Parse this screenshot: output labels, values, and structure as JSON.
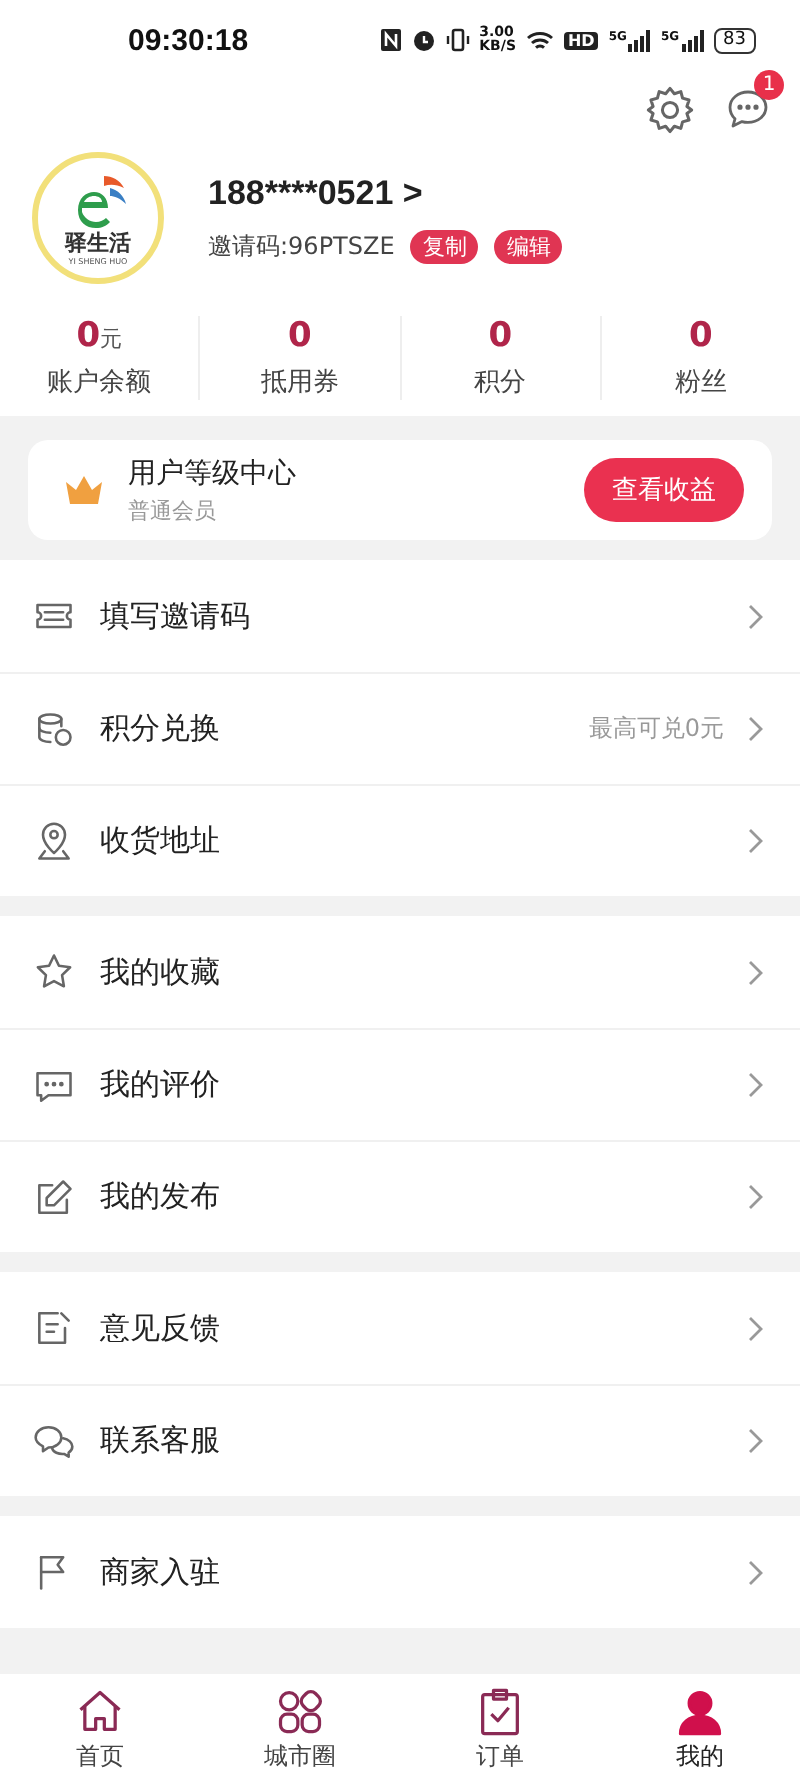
{
  "status_bar": {
    "time": "09:30:18",
    "speed_value": "3.00",
    "speed_unit": "KB/S",
    "hd": "HD",
    "signals": [
      "5G",
      "5G"
    ],
    "battery": "83"
  },
  "header": {
    "message_badge": "1"
  },
  "profile": {
    "logo_name": "驿生活",
    "logo_pinyin": "YI SHENG HUO",
    "phone": "188****0521 >",
    "invite_code": "邀请码:96PTSZE",
    "actions": [
      "复制",
      "编辑"
    ]
  },
  "stats": [
    {
      "value": "0",
      "unit": "元",
      "label": "账户余额"
    },
    {
      "value": "0",
      "label": "抵用券"
    },
    {
      "value": "0",
      "label": "积分"
    },
    {
      "value": "0",
      "label": "粉丝"
    }
  ],
  "level_card": {
    "title": "用户等级中心",
    "subtitle": "普通会员",
    "button": "查看收益"
  },
  "menu_groups": [
    [
      {
        "label": "填写邀请码"
      },
      {
        "label": "积分兑换",
        "value": "最高可兑0元"
      },
      {
        "label": "收货地址"
      }
    ],
    [
      {
        "label": "我的收藏"
      },
      {
        "label": "我的评价"
      },
      {
        "label": "我的发布"
      }
    ],
    [
      {
        "label": "意见反馈"
      },
      {
        "label": "联系客服"
      }
    ],
    [
      {
        "label": "商家入驻"
      }
    ]
  ],
  "tabs": [
    {
      "label": "首页",
      "selected": false
    },
    {
      "label": "城市圈",
      "selected": false
    },
    {
      "label": "订单",
      "selected": false
    },
    {
      "label": "我的",
      "selected": true
    }
  ]
}
